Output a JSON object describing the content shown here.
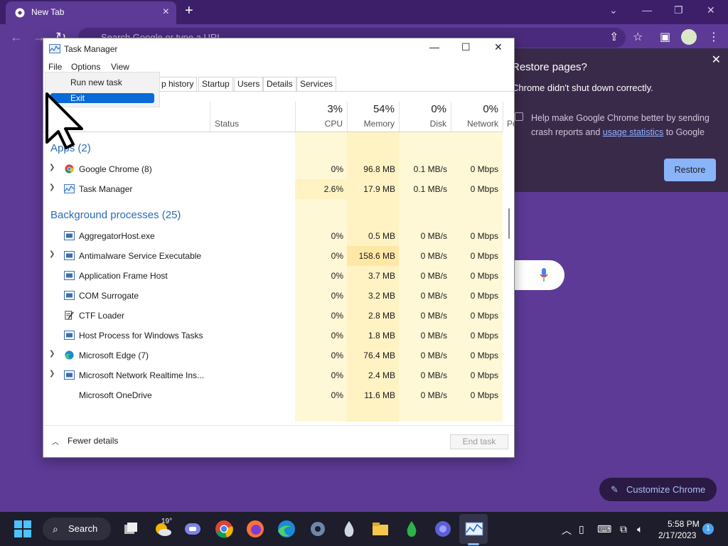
{
  "chrome": {
    "tab_title": "New Tab",
    "omnibox_placeholder": "Search Google or type a URL",
    "restore": {
      "title": "Restore pages?",
      "subtitle": "Chrome didn't shut down correctly.",
      "help_prefix": "Help make Google Chrome better by sending crash reports and ",
      "help_link": "usage statistics",
      "help_suffix": " to Google",
      "button": "Restore"
    },
    "customize": "Customize Chrome"
  },
  "task_manager": {
    "title": "Task Manager",
    "menu": [
      "File",
      "Options",
      "View"
    ],
    "file_menu": [
      "Run new task",
      "Exit"
    ],
    "tabs": [
      "p history",
      "Startup",
      "Users",
      "Details",
      "Services"
    ],
    "columns": {
      "status": "Status",
      "cpu": {
        "pct": "3%",
        "label": "CPU"
      },
      "memory": {
        "pct": "54%",
        "label": "Memory"
      },
      "disk": {
        "pct": "0%",
        "label": "Disk"
      },
      "network": {
        "pct": "0%",
        "label": "Network"
      },
      "power_partial": "Po"
    },
    "groups": {
      "apps": "Apps (2)",
      "background": "Background processes (25)"
    },
    "apps": [
      {
        "name": "Google Chrome (8)",
        "cpu": "0%",
        "memory": "96.8 MB",
        "disk": "0.1 MB/s",
        "network": "0 Mbps"
      },
      {
        "name": "Task Manager",
        "cpu": "2.6%",
        "memory": "17.9 MB",
        "disk": "0.1 MB/s",
        "network": "0 Mbps"
      }
    ],
    "background": [
      {
        "name": "AggregatorHost.exe",
        "cpu": "0%",
        "memory": "0.5 MB",
        "disk": "0 MB/s",
        "network": "0 Mbps"
      },
      {
        "name": "Antimalware Service Executable",
        "cpu": "0%",
        "memory": "158.6 MB",
        "disk": "0 MB/s",
        "network": "0 Mbps"
      },
      {
        "name": "Application Frame Host",
        "cpu": "0%",
        "memory": "3.7 MB",
        "disk": "0 MB/s",
        "network": "0 Mbps"
      },
      {
        "name": "COM Surrogate",
        "cpu": "0%",
        "memory": "3.2 MB",
        "disk": "0 MB/s",
        "network": "0 Mbps"
      },
      {
        "name": "CTF Loader",
        "cpu": "0%",
        "memory": "2.8 MB",
        "disk": "0 MB/s",
        "network": "0 Mbps"
      },
      {
        "name": "Host Process for Windows Tasks",
        "cpu": "0%",
        "memory": "1.8 MB",
        "disk": "0 MB/s",
        "network": "0 Mbps"
      },
      {
        "name": "Microsoft Edge (7)",
        "cpu": "0%",
        "memory": "76.4 MB",
        "disk": "0 MB/s",
        "network": "0 Mbps"
      },
      {
        "name": "Microsoft Network Realtime Ins...",
        "cpu": "0%",
        "memory": "2.4 MB",
        "disk": "0 MB/s",
        "network": "0 Mbps"
      },
      {
        "name": "Microsoft OneDrive",
        "cpu": "0%",
        "memory": "11.6 MB",
        "disk": "0 MB/s",
        "network": "0 Mbps"
      }
    ],
    "footer": {
      "fewer_details": "Fewer details",
      "end_task": "End task"
    }
  },
  "taskbar": {
    "search": "Search",
    "weather_temp": "19°",
    "time": "5:58 PM",
    "date": "2/17/2023",
    "notifications": "1"
  }
}
